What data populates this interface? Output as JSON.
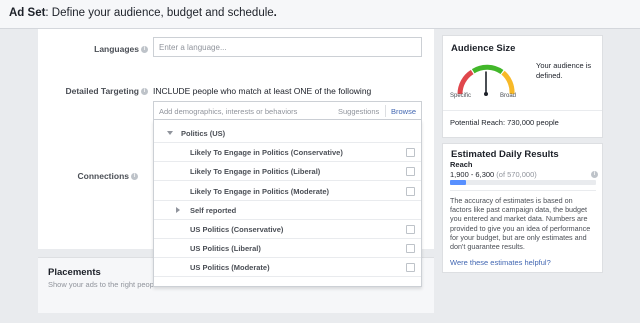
{
  "header": {
    "title_bold": "Ad Set",
    "title_rest": ": Define your audience, budget and schedule",
    "title_end": "."
  },
  "form": {
    "languages_label": "Languages",
    "languages_placeholder": "Enter a language...",
    "detailed_targeting_label": "Detailed Targeting",
    "include_text": "INCLUDE people who match at least ONE of the following",
    "search_placeholder": "Add demographics, interests or behaviors",
    "suggestions_label": "Suggestions",
    "browse_label": "Browse",
    "connections_label": "Connections"
  },
  "dropdown": {
    "items": [
      {
        "label": "Politics (US)",
        "type": "category-open"
      },
      {
        "label": "Likely To Engage in Politics (Conservative)",
        "type": "option"
      },
      {
        "label": "Likely To Engage in Politics (Liberal)",
        "type": "option"
      },
      {
        "label": "Likely To Engage in Politics (Moderate)",
        "type": "option"
      },
      {
        "label": "Self reported",
        "type": "category-closed"
      },
      {
        "label": "US Politics (Conservative)",
        "type": "option"
      },
      {
        "label": "US Politics (Liberal)",
        "type": "option"
      },
      {
        "label": "US Politics (Moderate)",
        "type": "option"
      }
    ]
  },
  "placements": {
    "title": "Placements",
    "desc": "Show your ads to the right peopl"
  },
  "audience_size": {
    "title": "Audience Size",
    "specific_label": "Specific",
    "broad_label": "Broad",
    "status": "Your audience is defined.",
    "potential_reach": "Potential Reach: 730,000 people",
    "gauge_level": 0.5
  },
  "daily_results": {
    "title": "Estimated Daily Results",
    "reach_label": "Reach",
    "reach_range": "1,900 - 6,300",
    "reach_of": "(of 570,000)",
    "reach_fraction": 0.11,
    "accuracy_text": "The accuracy of estimates is based on factors like past campaign data, the budget you entered and market data. Numbers are provided to give you an idea of performance for your budget, but are only estimates and don't guarantee results.",
    "helpful_link": "Were these estimates helpful?"
  },
  "colors": {
    "link": "#4267b2",
    "bar_fill": "#5890ff",
    "gauge_red": "#e0474c",
    "gauge_yellow": "#f7b928",
    "gauge_green": "#42b72a"
  }
}
